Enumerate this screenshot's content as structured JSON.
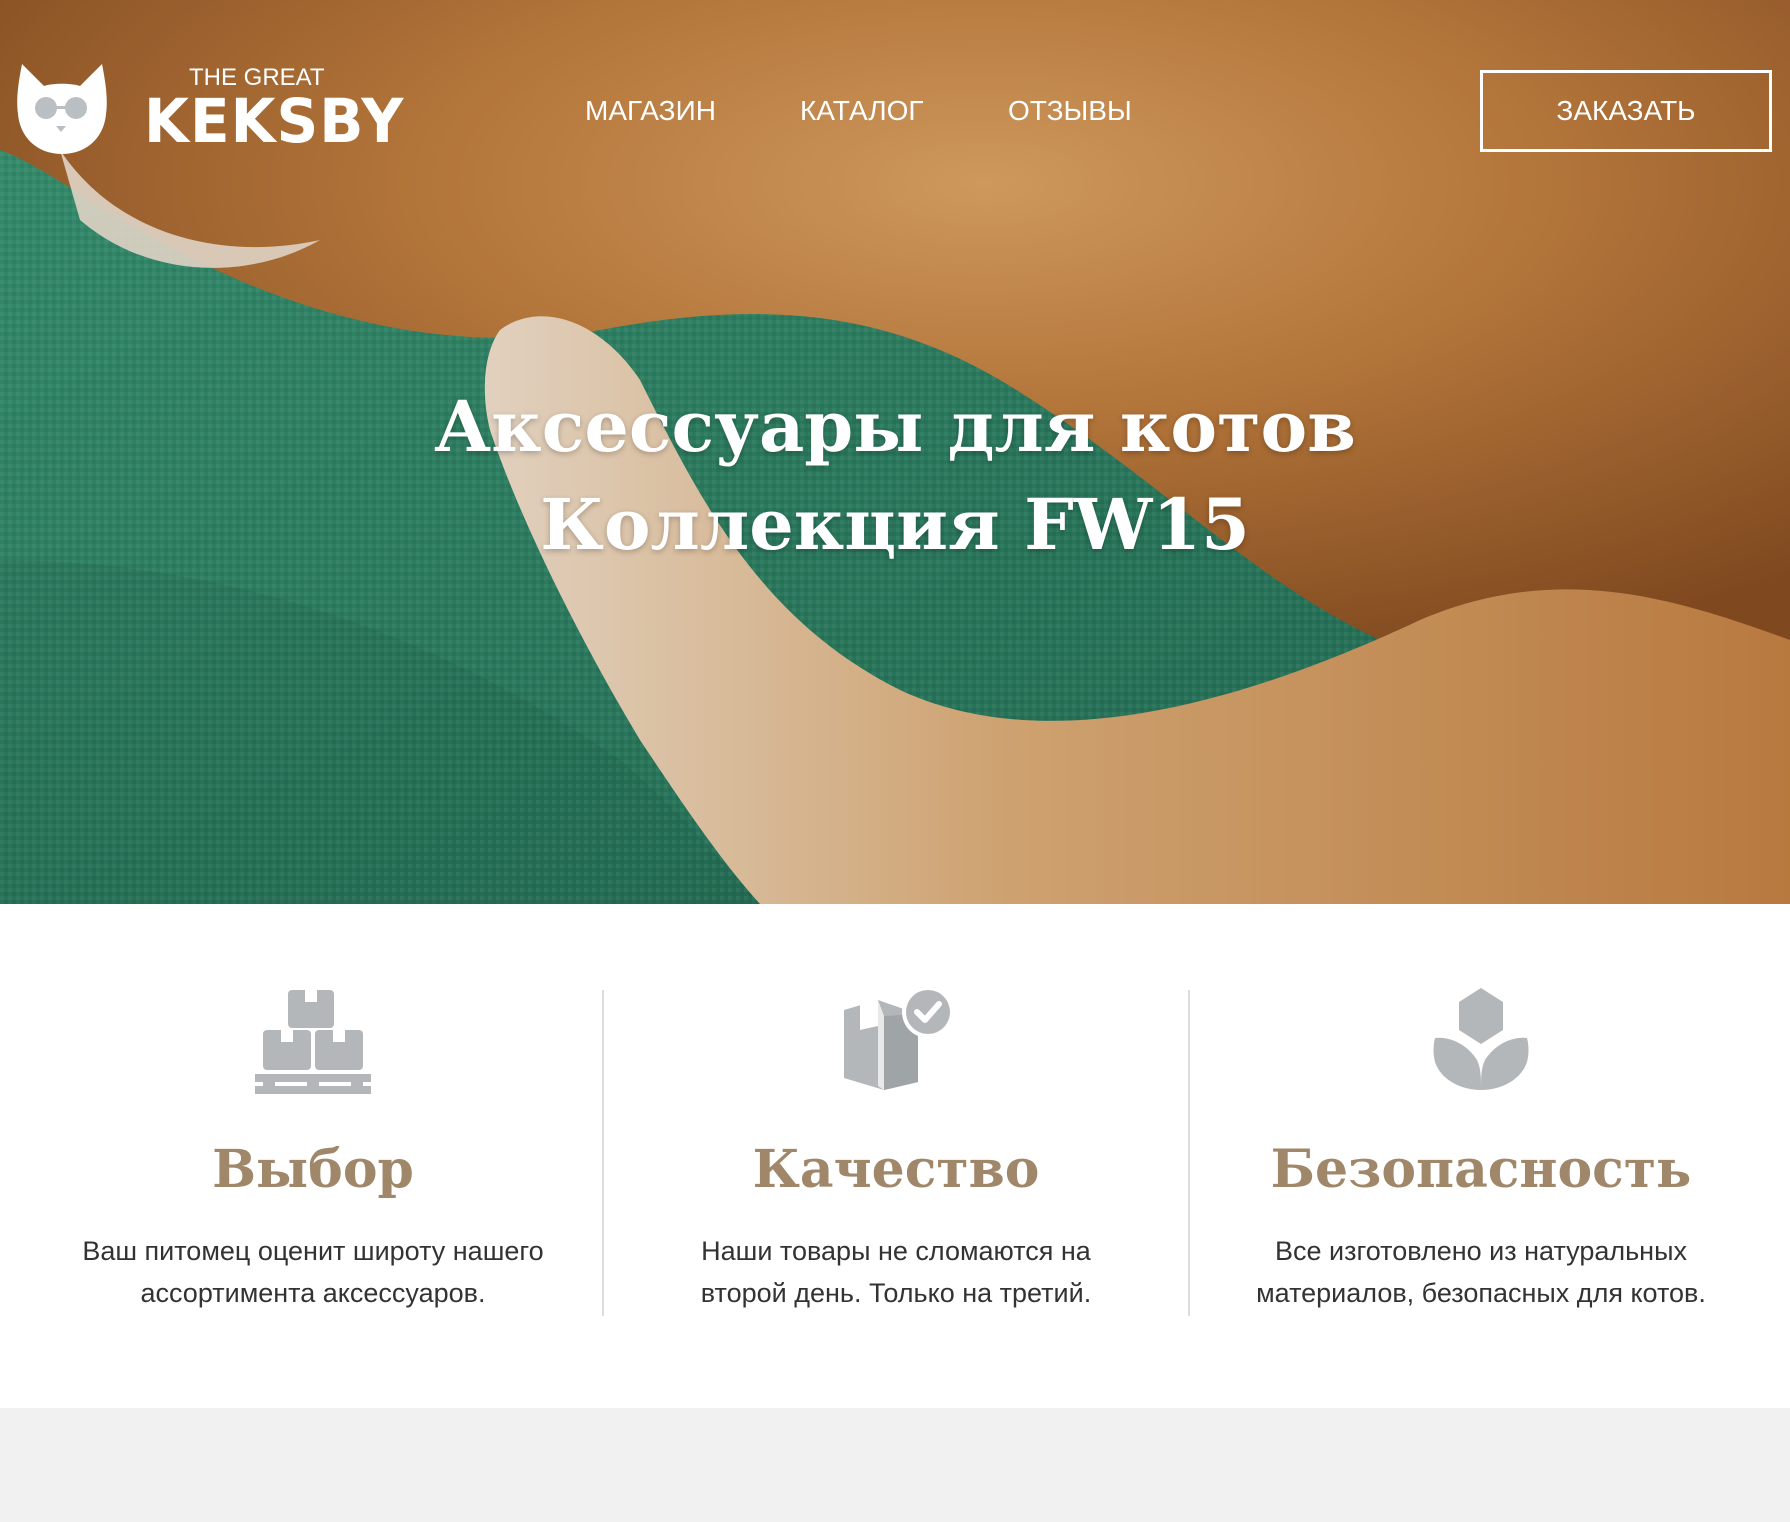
{
  "logo": {
    "small_text": "THE GREAT",
    "big_text": "KEKSBY"
  },
  "nav": {
    "items": [
      {
        "label": "МАГАЗИН"
      },
      {
        "label": "КАТАЛОГ"
      },
      {
        "label": "ОТЗЫВЫ"
      }
    ]
  },
  "order_button": {
    "label": "ЗАКАЗАТЬ"
  },
  "hero": {
    "title_line1": "Аксессуары для котов",
    "title_line2": "Коллекция FW15"
  },
  "features": [
    {
      "icon": "pallet-boxes-icon",
      "title": "Выбор",
      "text_line1": "Ваш питомец оценит широту нашего",
      "text_line2": "ассортимента аксессуаров."
    },
    {
      "icon": "box-check-icon",
      "title": "Качество",
      "text_line1": "Наши товары не сломаются на",
      "text_line2": "второй день. Только на третий."
    },
    {
      "icon": "leaf-sprout-icon",
      "title": "Безопасность",
      "text_line1": "Все изготовлено из натуральных",
      "text_line2": "материалов, безопасных для котов."
    }
  ],
  "colors": {
    "accent_title": "#a0876a",
    "icon_gray": "#b3b7ba",
    "bottom_band": "#f1f1f1",
    "hero_green": "#2f8a6a",
    "cat_fur": "#c98a4a"
  }
}
